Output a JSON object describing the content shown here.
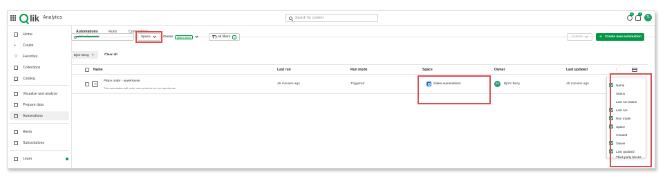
{
  "header": {
    "logo_text": "Qlik",
    "app_name": "Analytics",
    "search_placeholder": "Search for content",
    "notification_count": "12",
    "bell_count": "2",
    "user_initials": "TL"
  },
  "sidebar": {
    "items": [
      {
        "label": "Home",
        "icon": "home-icon"
      },
      {
        "label": "Create",
        "icon": "plus-icon"
      },
      {
        "label": "Favorites",
        "icon": "star-icon"
      },
      {
        "label": "Collections",
        "icon": "collections-icon"
      },
      {
        "label": "Catalog",
        "icon": "catalog-icon"
      },
      {
        "label": "Visualize and analyze",
        "icon": "visualize-icon"
      },
      {
        "label": "Prepare data",
        "icon": "prepare-data-icon"
      },
      {
        "label": "Automations",
        "icon": "automations-icon",
        "active": true
      },
      {
        "label": "Alerts",
        "icon": "alerts-icon"
      },
      {
        "label": "Subscriptions",
        "icon": "subscriptions-icon"
      },
      {
        "label": "Learn",
        "icon": "learn-icon"
      }
    ]
  },
  "tabs": [
    {
      "label": "Automations",
      "active": true
    },
    {
      "label": "Runs"
    },
    {
      "label": "Connections"
    }
  ],
  "toolbar": {
    "filter_placeholder": "Filter by name",
    "space_label": "Space",
    "owner_label": "Owner",
    "owner_chip": "Björn Berg",
    "all_filters_label": "All filters",
    "all_filters_count": "1",
    "actions_label": "Actions",
    "create_label": "Create new automation"
  },
  "applied_filters": {
    "chip_label": "Björn Berg",
    "clear_all_label": "Clear all"
  },
  "table": {
    "columns": [
      "Name",
      "Last run",
      "Run mode",
      "Space",
      "Owner",
      "Last updated"
    ],
    "rows": [
      {
        "name": "Place order - warehouse",
        "description": "This automation will order new products for our warehouse",
        "last_run": "46 minutes ago",
        "run_mode": "Triggered",
        "space": "Sales automations",
        "owner_initials": "BB",
        "owner": "Björn Berg",
        "last_updated": "45 minutes ago"
      }
    ]
  },
  "column_menu": {
    "items": [
      {
        "label": "Name",
        "checked": true
      },
      {
        "label": "Status",
        "checked": false
      },
      {
        "label": "Last run status",
        "checked": false
      },
      {
        "label": "Last run",
        "checked": true
      },
      {
        "label": "Run mode",
        "checked": true
      },
      {
        "label": "Space",
        "checked": true
      },
      {
        "label": "Created",
        "checked": false
      },
      {
        "label": "Owner",
        "checked": true
      },
      {
        "label": "Last updated",
        "checked": true
      },
      {
        "label": "Third-party blocks",
        "checked": false
      }
    ]
  },
  "colors": {
    "accent": "#009845",
    "highlight": "#d94f4f",
    "space_icon": "#1a6fd0"
  }
}
